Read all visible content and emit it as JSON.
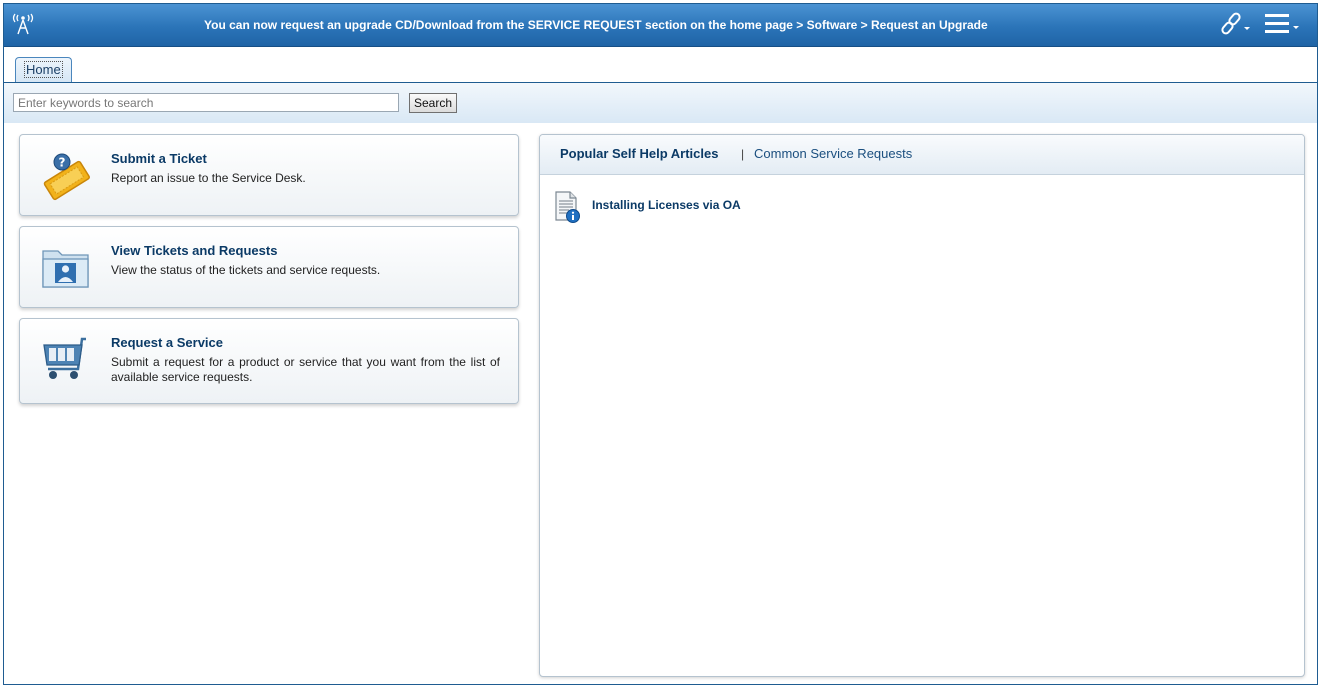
{
  "banner": {
    "message": "You can now request an upgrade CD/Download from the SERVICE REQUEST section on the home page > Software > Request an Upgrade",
    "left_icon": "antenna-icon",
    "right_icons": [
      "link-icon",
      "hamburger-menu-icon"
    ]
  },
  "tabs": [
    {
      "label": "Home",
      "selected": true
    }
  ],
  "search": {
    "placeholder": "Enter keywords to search",
    "value": "",
    "button_label": "Search"
  },
  "actions": [
    {
      "icon": "ticket-icon",
      "title": "Submit a Ticket",
      "description": "Report an issue to the Service Desk."
    },
    {
      "icon": "folder-user-icon",
      "title": "View Tickets and Requests",
      "description": "View the status of the tickets and service requests."
    },
    {
      "icon": "shopping-cart-icon",
      "title": "Request a Service",
      "description": "Submit a request for a product or service that you want from the list of available service requests."
    }
  ],
  "panel": {
    "tabs": [
      {
        "label": "Popular Self Help Articles",
        "selected": true
      },
      {
        "label": "Common Service Requests",
        "selected": false
      }
    ],
    "separator": "|",
    "articles": [
      {
        "icon": "document-info-icon",
        "title": "Installing Licenses via OA"
      }
    ]
  },
  "colors": {
    "banner": "#2b74b8",
    "accent_text": "#0b3a66",
    "border": "#1f5c91"
  }
}
